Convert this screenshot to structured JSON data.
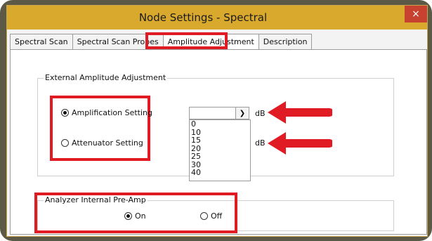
{
  "window": {
    "title": "Node Settings - Spectral",
    "close_label": "×"
  },
  "tabs": [
    {
      "label": "Spectral Scan"
    },
    {
      "label": "Spectral Scan Probes"
    },
    {
      "label": "Amplitude Adjustment"
    },
    {
      "label": "Description"
    }
  ],
  "external_group": {
    "legend": "External Amplitude Adjustment",
    "amplification_label": "Amplification Setting",
    "attenuator_label": "Attenuator Setting",
    "unit_top": "dB",
    "unit_bottom": "dB",
    "dropdown_value": "",
    "options": [
      "0",
      "10",
      "15",
      "20",
      "25",
      "30",
      "40"
    ]
  },
  "preamp_group": {
    "legend": "Analyzer Internal Pre-Amp",
    "on_label": "On",
    "off_label": "Off"
  },
  "colors": {
    "highlight": "#e01b24",
    "titlebar": "#d9a92e",
    "frame": "#5c5a46"
  }
}
